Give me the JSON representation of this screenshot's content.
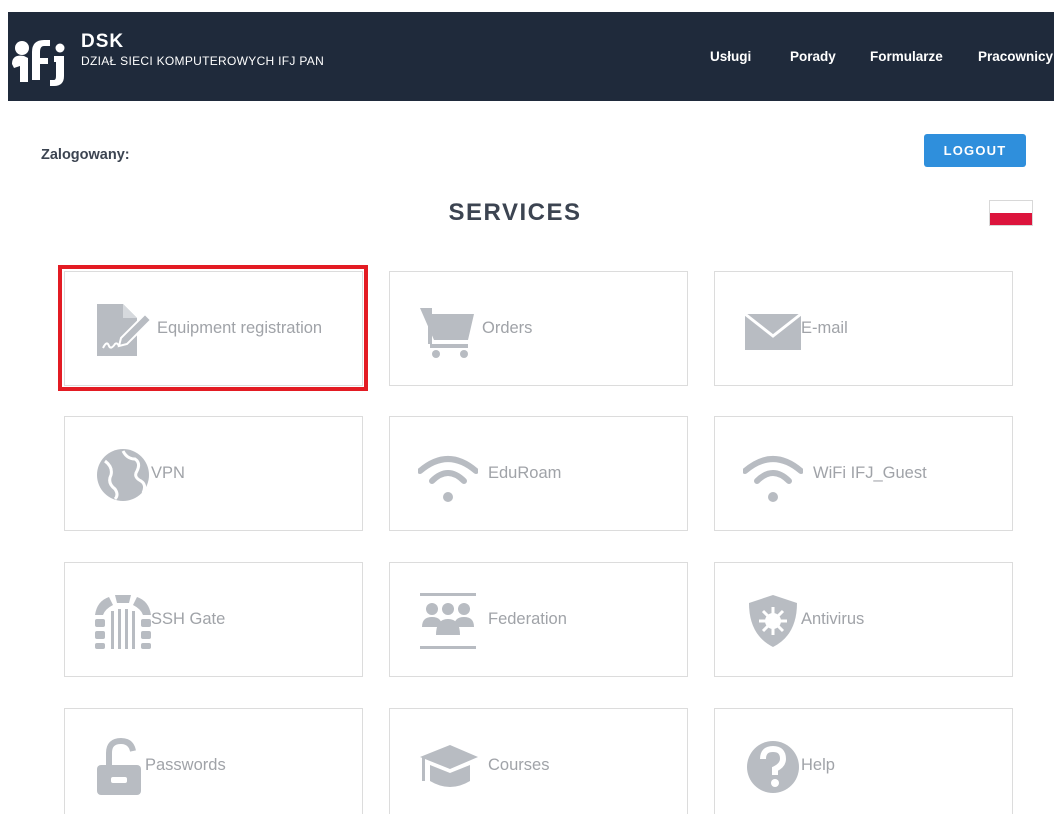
{
  "header": {
    "brand_title": "DSK",
    "brand_subtitle": "DZIAŁ SIECI KOMPUTEROWYCH IFJ PAN",
    "nav": [
      "Usługi",
      "Porady",
      "Formularze",
      "Pracownicy"
    ]
  },
  "user": {
    "logged_label": "Zalogowany:"
  },
  "logout_label": "LOGOUT",
  "page_title": "SERVICES",
  "language_flag": "polish-flag",
  "tiles": [
    {
      "label": "Equipment registration",
      "icon": "contract-sign-icon"
    },
    {
      "label": "Orders",
      "icon": "cart-icon"
    },
    {
      "label": "E-mail",
      "icon": "envelope-icon"
    },
    {
      "label": "VPN",
      "icon": "globe-icon"
    },
    {
      "label": "EduRoam",
      "icon": "wifi-icon"
    },
    {
      "label": "WiFi IFJ_Guest",
      "icon": "wifi-icon"
    },
    {
      "label": "SSH Gate",
      "icon": "gate-icon"
    },
    {
      "label": "Federation",
      "icon": "group-icon"
    },
    {
      "label": "Antivirus",
      "icon": "shield-virus-icon"
    },
    {
      "label": "Passwords",
      "icon": "unlock-icon"
    },
    {
      "label": "Courses",
      "icon": "graduation-cap-icon"
    },
    {
      "label": "Help",
      "icon": "question-icon"
    }
  ],
  "colors": {
    "header_bg": "#1f2a3b",
    "accent_blue": "#2f8fdc",
    "highlight_red": "#e31b23",
    "icon_gray": "#b8bcc2",
    "label_gray": "#a0a3a8"
  }
}
